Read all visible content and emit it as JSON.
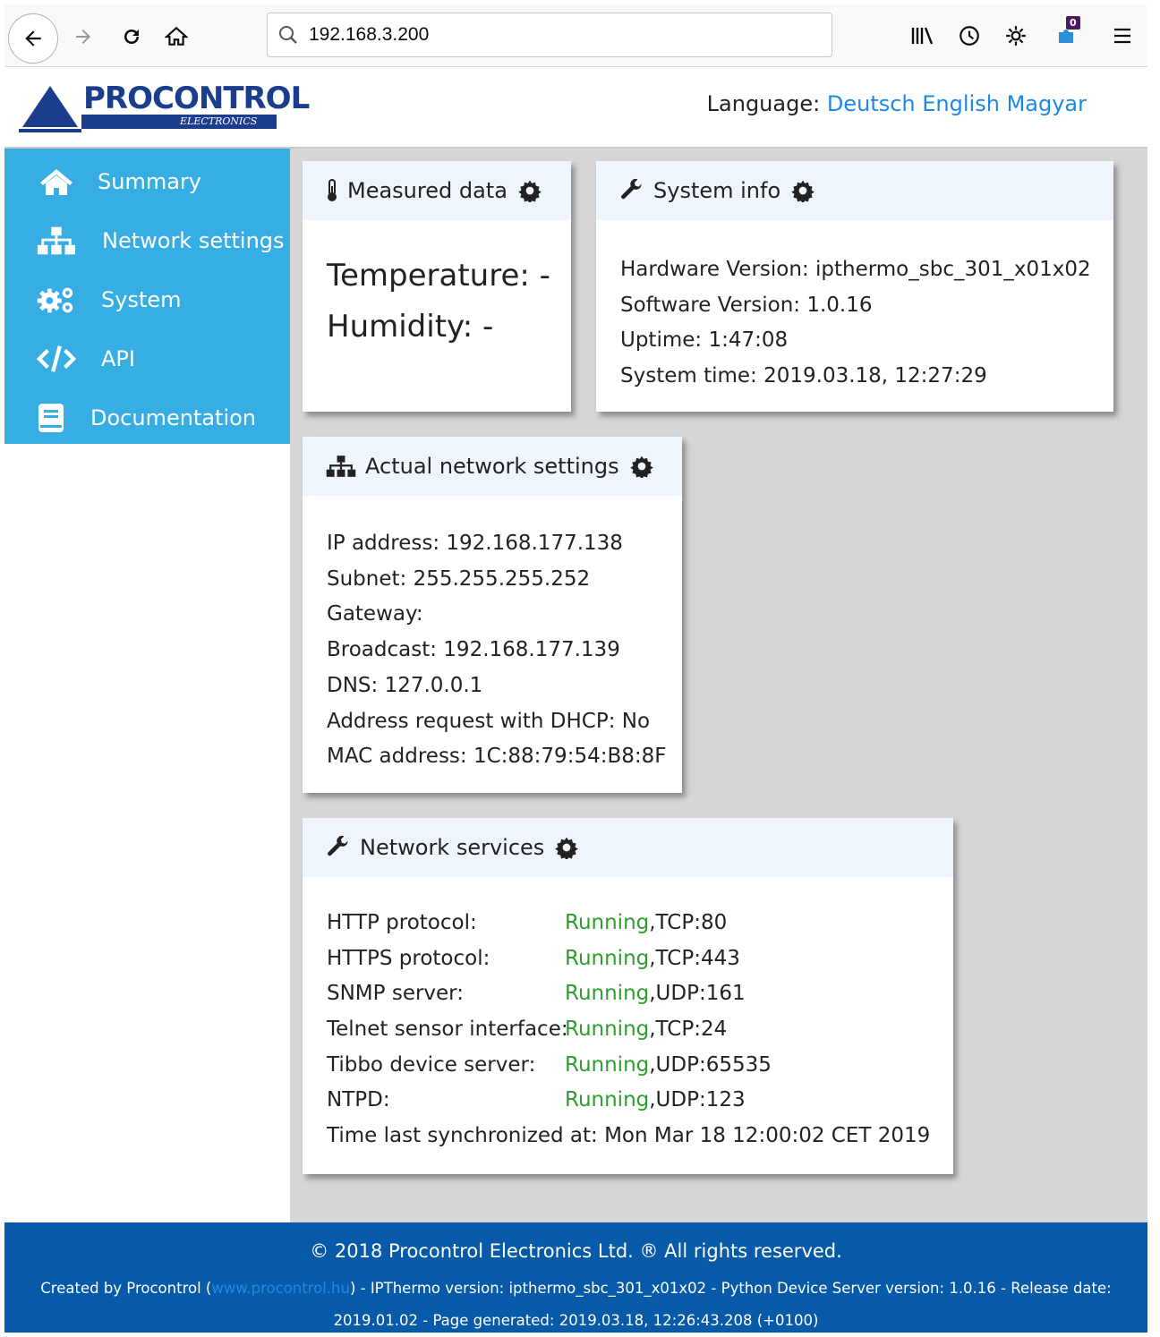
{
  "browser": {
    "url": "192.168.3.200",
    "extension_badge": "0"
  },
  "brand": {
    "logo_text": "PROCONTROL",
    "logo_sub": "ELECTRONICS"
  },
  "header": {
    "language_label": "Language:",
    "languages": [
      "Deutsch",
      "English",
      "Magyar"
    ]
  },
  "sidebar": {
    "items": [
      {
        "label": "Summary",
        "icon": "home-icon"
      },
      {
        "label": "Network settings",
        "icon": "sitemap-icon"
      },
      {
        "label": "System",
        "icon": "cogs-icon"
      },
      {
        "label": "API",
        "icon": "code-icon"
      },
      {
        "label": "Documentation",
        "icon": "book-icon"
      }
    ]
  },
  "measured": {
    "title": "Measured data",
    "temperature": "Temperature: -",
    "humidity": "Humidity: -"
  },
  "sysinfo": {
    "title": "System info",
    "rows": [
      "Hardware Version: ipthermo_sbc_301_x01x02",
      "Software Version: 1.0.16",
      "Uptime: 1:47:08",
      "System time: 2019.03.18, 12:27:29"
    ]
  },
  "netset": {
    "title": "Actual network settings",
    "rows": [
      "IP address: 192.168.177.138",
      "Subnet: 255.255.255.252",
      "Gateway:",
      "Broadcast: 192.168.177.139",
      "DNS: 127.0.0.1",
      "Address request with DHCP: No",
      "MAC address: 1C:88:79:54:B8:8F"
    ]
  },
  "netsvc": {
    "title": "Network services",
    "services": [
      {
        "name": "HTTP protocol:",
        "status": "Running",
        "port": ",TCP:80"
      },
      {
        "name": "HTTPS protocol:",
        "status": "Running",
        "port": ",TCP:443"
      },
      {
        "name": "SNMP server:",
        "status": "Running",
        "port": ",UDP:161"
      },
      {
        "name": "Telnet sensor interface:",
        "status": "Running",
        "port": ",TCP:24"
      },
      {
        "name": "Tibbo device server:",
        "status": "Running",
        "port": ",UDP:65535"
      },
      {
        "name": "NTPD:",
        "status": "Running",
        "port": ",UDP:123"
      }
    ],
    "sync": "Time last synchronized at: Mon Mar 18 12:00:02 CET 2019"
  },
  "footer": {
    "copyright": "© 2018 Procontrol Electronics Ltd. ® All rights reserved.",
    "created_prefix": "Created by Procontrol (",
    "link": "www.procontrol.hu",
    "created_suffix": ") - IPThermo version: ipthermo_sbc_301_x01x02 - Python Device Server version: 1.0.16 - Release date: 2019.01.02 - Page generated: 2019.03.18, 12:26:43.208 (+0100)"
  },
  "colors": {
    "sidebar": "#37aee3",
    "footer": "#075aa8",
    "running": "#2e9e2e",
    "link": "#1e88e5"
  }
}
